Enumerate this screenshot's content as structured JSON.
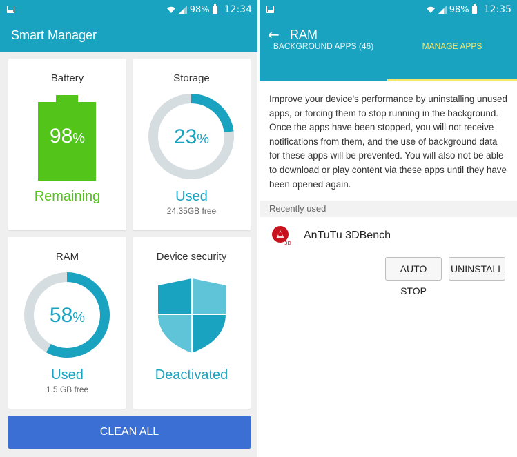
{
  "left": {
    "status": {
      "battery_pct": "98%",
      "time": "12:34"
    },
    "title": "Smart Manager",
    "battery": {
      "title": "Battery",
      "value_num": "98",
      "unit": "%",
      "label": "Remaining",
      "level": 0.98,
      "color": "#52c41a"
    },
    "storage": {
      "title": "Storage",
      "value_num": "23",
      "unit": "%",
      "label": "Used",
      "sub": "24.35GB free",
      "fraction": 0.23,
      "color": "#1aa3c0"
    },
    "ram": {
      "title": "RAM",
      "value_num": "58",
      "unit": "%",
      "label": "Used",
      "sub": "1.5 GB free",
      "fraction": 0.58,
      "color": "#1aa3c0"
    },
    "security": {
      "title": "Device security",
      "label": "Deactivated",
      "color": "#1aa3c0"
    },
    "clean_button": "CLEAN ALL"
  },
  "right": {
    "status": {
      "battery_pct": "98%",
      "time": "12:35"
    },
    "title": "RAM",
    "tabs": [
      {
        "label": "BACKGROUND APPS (46)",
        "active": false
      },
      {
        "label": "MANAGE APPS",
        "active": true
      }
    ],
    "description": "Improve your device's performance by uninstalling unused apps, or forcing them to stop running in the background. Once the apps have been stopped, you will not receive notifications from them, and the use of background data for these apps will be prevented. You will also not be able to download or play content via these apps until they have been opened again.",
    "section_header": "Recently used",
    "app": {
      "name": "AnTuTu 3DBench",
      "icon_badge": "3D"
    },
    "buttons": {
      "auto_stop": "AUTO STOP",
      "uninstall": "UNINSTALL"
    }
  }
}
